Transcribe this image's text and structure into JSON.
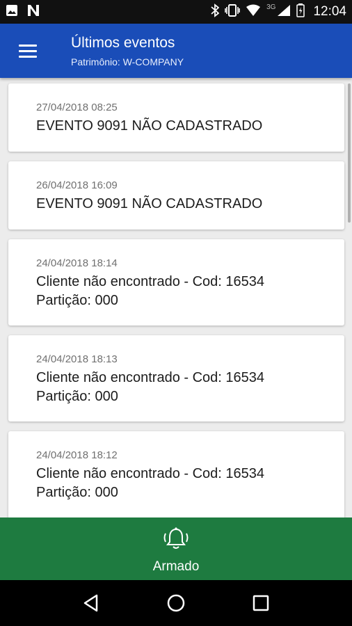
{
  "status_bar": {
    "time": "12:04",
    "network": "3G",
    "icons": [
      "image-icon",
      "n-notification-icon",
      "bluetooth-icon",
      "vibrate-icon",
      "wifi-icon",
      "signal-icon",
      "battery-icon"
    ]
  },
  "app_bar": {
    "title": "Últimos eventos",
    "subtitle": "Patrimônio: W-COMPANY",
    "color": "#1a4db8"
  },
  "events": [
    {
      "date": "27/04/2018 08:25",
      "message": "EVENTO 9091 NÃO CADASTRADO"
    },
    {
      "date": "26/04/2018 16:09",
      "message": "EVENTO 9091 NÃO CADASTRADO"
    },
    {
      "date": "24/04/2018 18:14",
      "message": "Cliente não encontrado - Cod: 16534\nPartição: 000"
    },
    {
      "date": "24/04/2018 18:13",
      "message": "Cliente não encontrado - Cod: 16534\nPartição: 000"
    },
    {
      "date": "24/04/2018 18:12",
      "message": "Cliente não encontrado - Cod: 16534\nPartição: 000"
    }
  ],
  "bottom_action": {
    "label": "Armado",
    "icon": "bell-ringing-icon",
    "color": "#1e7b40"
  },
  "nav_bar": {
    "buttons": [
      "back-icon",
      "home-icon",
      "recents-icon"
    ]
  }
}
